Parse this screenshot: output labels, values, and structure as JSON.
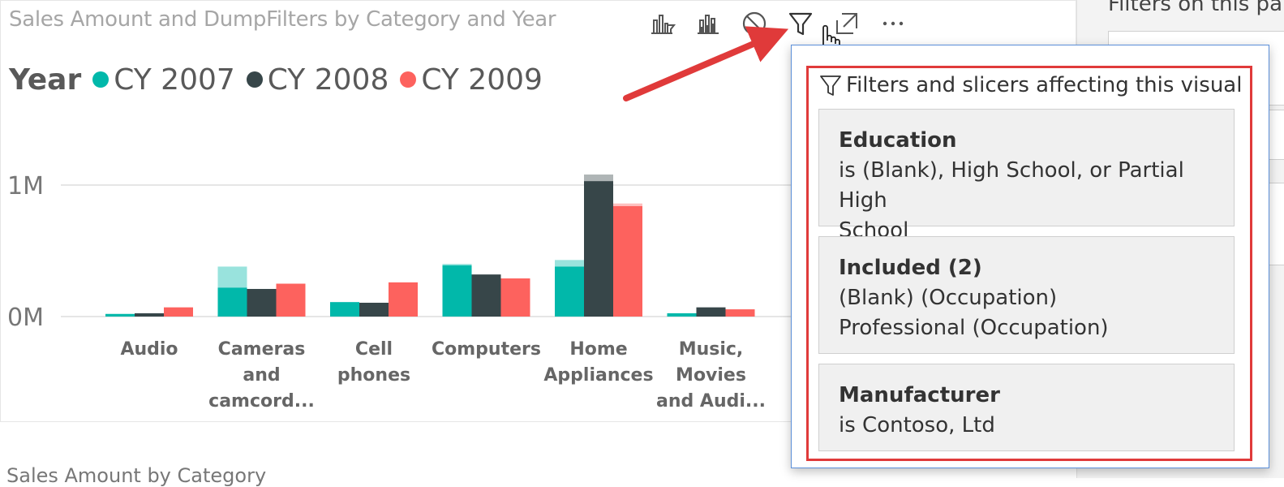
{
  "visual": {
    "title": "Sales Amount and DumpFilters by Category and Year",
    "toolbar": [
      {
        "name": "drill-filter-icon"
      },
      {
        "name": "bar-chart-icon"
      },
      {
        "name": "no-entry-icon"
      },
      {
        "name": "filter-icon"
      },
      {
        "name": "focus-mode-icon"
      },
      {
        "name": "more-options-icon"
      }
    ]
  },
  "legend": {
    "title": "Year",
    "items": [
      {
        "label": "CY 2007",
        "color": "#01b8aa"
      },
      {
        "label": "CY 2008",
        "color": "#374649"
      },
      {
        "label": "CY 2009",
        "color": "#fd625e"
      }
    ]
  },
  "chart_data": {
    "type": "bar",
    "categories": [
      [
        "Audio"
      ],
      [
        "Cameras",
        "and",
        "camcord..."
      ],
      [
        "Cell",
        "phones"
      ],
      [
        "Computers"
      ],
      [
        "Home",
        "Appliances"
      ],
      [
        "Music,",
        "Movies",
        "and Audi..."
      ]
    ],
    "yticks": [
      "1M",
      "0M"
    ],
    "ylim": [
      0,
      1.0
    ],
    "series": [
      {
        "name": "CY 2007",
        "color": "#01b8aa",
        "values": [
          0.02,
          0.22,
          0.11,
          0.39,
          0.38,
          0.025
        ],
        "extra": [
          0,
          0.16,
          0,
          0.01,
          0.05,
          0
        ]
      },
      {
        "name": "CY 2008",
        "color": "#374649",
        "values": [
          0.025,
          0.21,
          0.105,
          0.32,
          1.03,
          0.07
        ],
        "extra": [
          0,
          0,
          0,
          0,
          0.05,
          0
        ]
      },
      {
        "name": "CY 2009",
        "color": "#fd625e",
        "values": [
          0.07,
          0.25,
          0.26,
          0.29,
          0.84,
          0.055
        ],
        "extra": [
          0,
          0,
          0,
          0,
          0.02,
          0
        ]
      }
    ]
  },
  "flyout": {
    "header": "Filters and slicers affecting this visual",
    "cards": [
      {
        "name": "Education",
        "lines": [
          "is (Blank), High School, or Partial High",
          "School"
        ]
      },
      {
        "name": "Included (2)",
        "lines": [
          "(Blank) (Occupation)",
          "Professional (Occupation)"
        ]
      },
      {
        "name": "Manufacturer",
        "lines": [
          "is Contoso, Ltd"
        ]
      }
    ]
  },
  "right_panel": {
    "title": "Filters on this pa"
  },
  "bottom": {
    "caption": "Sales Amount by Category"
  }
}
